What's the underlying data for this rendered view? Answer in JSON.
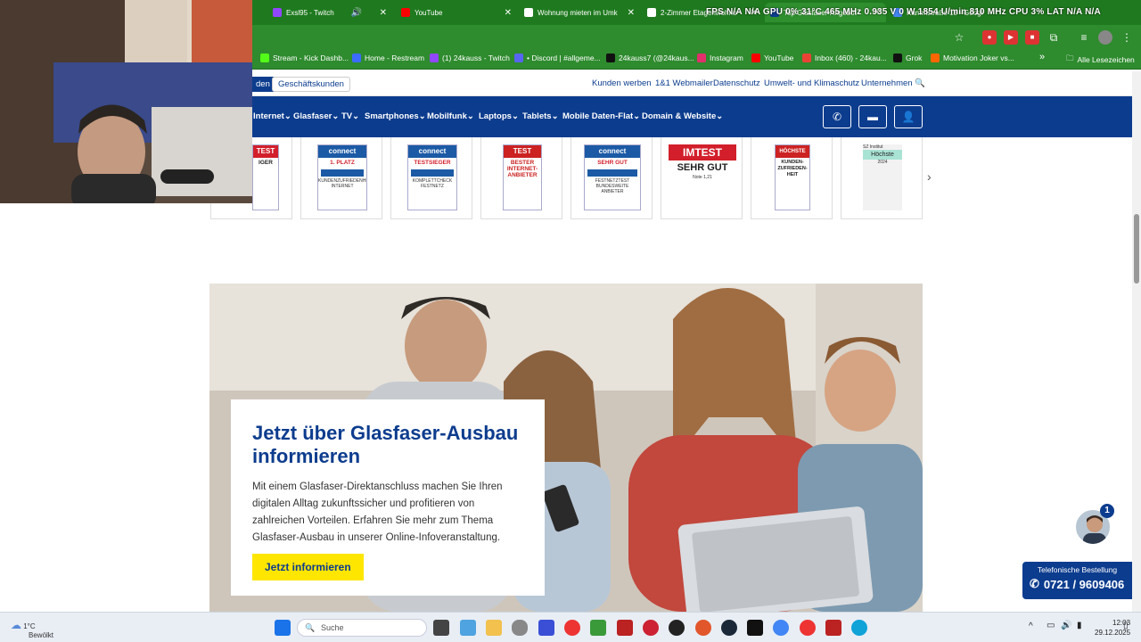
{
  "browser": {
    "tabs": [
      {
        "label": "Exsl95 - Twitch",
        "color": "#9146ff"
      },
      {
        "label": "YouTube",
        "color": "#ff0000"
      },
      {
        "label": "Wohnung mieten im Umk",
        "color": "#ffffff"
      },
      {
        "label": "2-Zimmer Etagenwohnu",
        "color": "#ffffff"
      },
      {
        "label": "Top Glasfaser-Angebot",
        "color": "#0c3c8e"
      },
      {
        "label": "Kammstraße 13 - Googl",
        "color": "#4285f4"
      }
    ],
    "overlay": "FPS N/A  N/A    GPU  0%  31°C  465 MHz 0.935 V  0 W  1854 U/min 810 MHz    CPU  3%    LAT  N/A  N/A",
    "bookmarks": [
      {
        "label": "Stream - Kick Dashb...",
        "color": "#53fc18"
      },
      {
        "label": "Home - Restream",
        "color": "#3b6bff"
      },
      {
        "label": "(1) 24kauss - Twitch",
        "color": "#9146ff"
      },
      {
        "label": "• Discord | #allgeme...",
        "color": "#5865f2"
      },
      {
        "label": "24kauss7 (@24kaus...",
        "color": "#111111"
      },
      {
        "label": "Instagram",
        "color": "#e1306c"
      },
      {
        "label": "YouTube",
        "color": "#ff0000"
      },
      {
        "label": "Inbox (460) - 24kau...",
        "color": "#ea4335"
      },
      {
        "label": "Grok",
        "color": "#111111"
      },
      {
        "label": "Motivation Joker vs...",
        "color": "#ff6600"
      }
    ],
    "bookmarks_more": "»",
    "all_bookmarks": "Alle Lesezeichen"
  },
  "page": {
    "meta_nav": {
      "private": "den",
      "business": "Geschäftskunden",
      "links": [
        "Kunden werben",
        "1&1 Webmailer",
        "Datenschutz",
        "Umwelt- und Klimaschutz",
        "Unternehmen"
      ]
    },
    "main_nav": [
      "Internet",
      "Glasfaser",
      "TV",
      "Smartphones",
      "Mobilfunk",
      "Laptops",
      "Tablets",
      "Mobile Daten-Flat",
      "Domain & Website"
    ],
    "awards": [
      {
        "head": "TEST",
        "title": "IGER",
        "color": "#d21f2b"
      },
      {
        "head": "connect",
        "title": "1. PLATZ",
        "sub": "KUNDENZUFRIEDENHEIT INTERNET",
        "color": "#1c5aa6"
      },
      {
        "head": "connect",
        "title": "TESTSIEGER",
        "sub": "KOMPLETTCHECK FESTNETZ",
        "color": "#1c5aa6"
      },
      {
        "head": "TEST",
        "title": "BESTER INTERNET-ANBIETER",
        "color": "#c22"
      },
      {
        "head": "connect",
        "title": "SEHR GUT",
        "sub": "FESTNETZTEST BUNDESWEITE ANBIETER",
        "color": "#1c5aa6"
      },
      {
        "head": "IMTEST",
        "title": "SEHR GUT",
        "sub": "Note 1,21",
        "color": "#d21f2b"
      },
      {
        "head": "HÖCHSTE",
        "title": "KUNDEN-ZUFRIEDEN-HEIT",
        "color": "#c22"
      },
      {
        "head": "SZ Institut",
        "title": "Höchste",
        "sub": "2024",
        "color": "#39b8a0"
      }
    ],
    "promo": {
      "title": "Jetzt über Glasfaser-Ausbau informieren",
      "text": "Mit einem Glasfaser-Direktanschluss machen Sie Ihren digitalen Alltag zukunftssicher und profitieren von zahlreichen Vorteilen. Erfahren Sie mehr zum Thema Glasfaser-Ausbau in unserer Online-Infoveranstaltung.",
      "cta": "Jetzt informieren"
    },
    "chat_badge": "1",
    "phone": {
      "label": "Telefonische Bestellung",
      "number": "0721 / 9609406"
    }
  },
  "taskbar": {
    "weather_temp": "1°C",
    "weather_desc": "Bewölkt",
    "search": "Suche",
    "time": "12:03",
    "date": "29.12.2025"
  }
}
